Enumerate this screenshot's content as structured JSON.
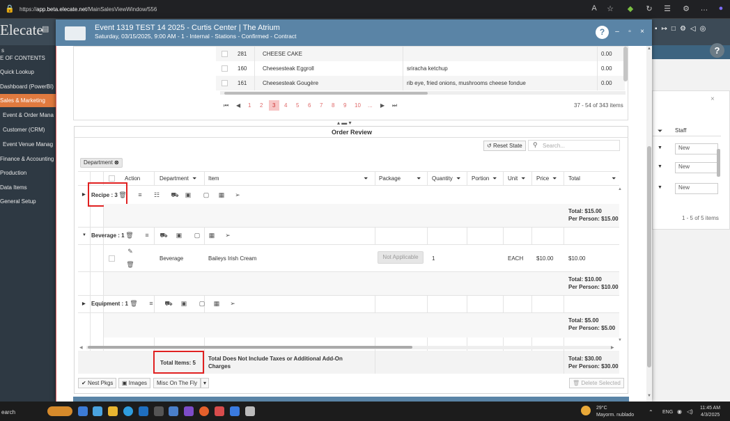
{
  "browser": {
    "url_prefix": "https://",
    "url_host": "app.beta.elecate.net",
    "url_path": "/MainSalesViewWindow/556"
  },
  "app": {
    "brand": "Elecate"
  },
  "sidebar": {
    "partial_top": "s",
    "items": [
      {
        "label": "E OF CONTENTS",
        "active": false
      },
      {
        "label": "Quick Lookup",
        "active": false
      },
      {
        "label": "Dashboard (PowerBI)",
        "active": false
      },
      {
        "label": "Sales & Marketing",
        "active": true
      },
      {
        "label": "Event & Order Mana",
        "active": false
      },
      {
        "label": "Customer (CRM)",
        "active": false
      },
      {
        "label": "Event Venue Manag",
        "active": false
      },
      {
        "label": "Finance & Accounting",
        "active": false
      },
      {
        "label": "Production",
        "active": false
      },
      {
        "label": "Data Items",
        "active": false
      },
      {
        "label": "General Setup",
        "active": false
      }
    ]
  },
  "right_panel": {
    "col_staff": "Staff",
    "rows": [
      "New",
      "New",
      "New"
    ],
    "pager": "1 - 5 of 5 items"
  },
  "modal": {
    "title": "Event 1319 TEST 14 2025 - Curtis Center | The Atrium",
    "subtitle": "Saturday, 03/15/2025, 9:00 AM - 1 - Internal - Stations - Confirmed - Contract",
    "help": "?"
  },
  "product_list": {
    "rows": [
      {
        "id": "281",
        "name": "CHEESE CAKE",
        "desc": "",
        "price": "0.00"
      },
      {
        "id": "160",
        "name": "Cheesesteak Eggroll",
        "desc": "sriracha ketchup",
        "price": "0.00"
      },
      {
        "id": "161",
        "name": "Cheesesteak Gougère",
        "desc": "rib eye, fried onions, mushrooms cheese fondue",
        "price": "0.00"
      }
    ],
    "pages": [
      "1",
      "2",
      "3",
      "4",
      "5",
      "6",
      "7",
      "8",
      "9",
      "10",
      "..."
    ],
    "current_page": "3",
    "summary": "37 - 54 of 343 items"
  },
  "order_review": {
    "title": "Order Review",
    "reset_label": "Reset State",
    "search_placeholder": "Search...",
    "group_chip": "Department",
    "columns": {
      "action": "Action",
      "department": "Department",
      "item": "Item",
      "package": "Package",
      "quantity": "Quantity",
      "portion": "Portion",
      "unit": "Unit",
      "price": "Price",
      "total": "Total"
    },
    "groups": [
      {
        "label": "Recipe : 3",
        "total": "Total: $15.00",
        "per_person": "Per Person: $15.00"
      },
      {
        "label": "Beverage : 1",
        "total": "Total: $10.00",
        "per_person": "Per Person: $10.00"
      },
      {
        "label": "Equipment : 1",
        "total": "Total: $5.00",
        "per_person": "Per Person: $5.00"
      }
    ],
    "beverage_row": {
      "department": "Beverage",
      "item": "Baileys Irish Cream",
      "package": "Not Applicable",
      "quantity": "1",
      "unit": "EACH",
      "price": "$10.00",
      "total": "$10.00"
    },
    "footer": {
      "total_items": "Total Items: 5",
      "note_line1": "Total Does Not Include Taxes or Additional Add-On",
      "note_line2": "Charges",
      "grand_total": "Total: $30.00",
      "grand_per_person": "Per Person: $30.00"
    },
    "buttons": {
      "nest_pkgs": "Nest Pkgs",
      "images": "Images",
      "misc": "Misc On The Fly",
      "delete_selected": "Delete Selected"
    }
  },
  "taskbar": {
    "search": "earch",
    "temp": "29°C",
    "weather": "Mayorm. nublado",
    "lang": "ENG",
    "time": "11:45 AM",
    "date": "4/3/2025"
  }
}
